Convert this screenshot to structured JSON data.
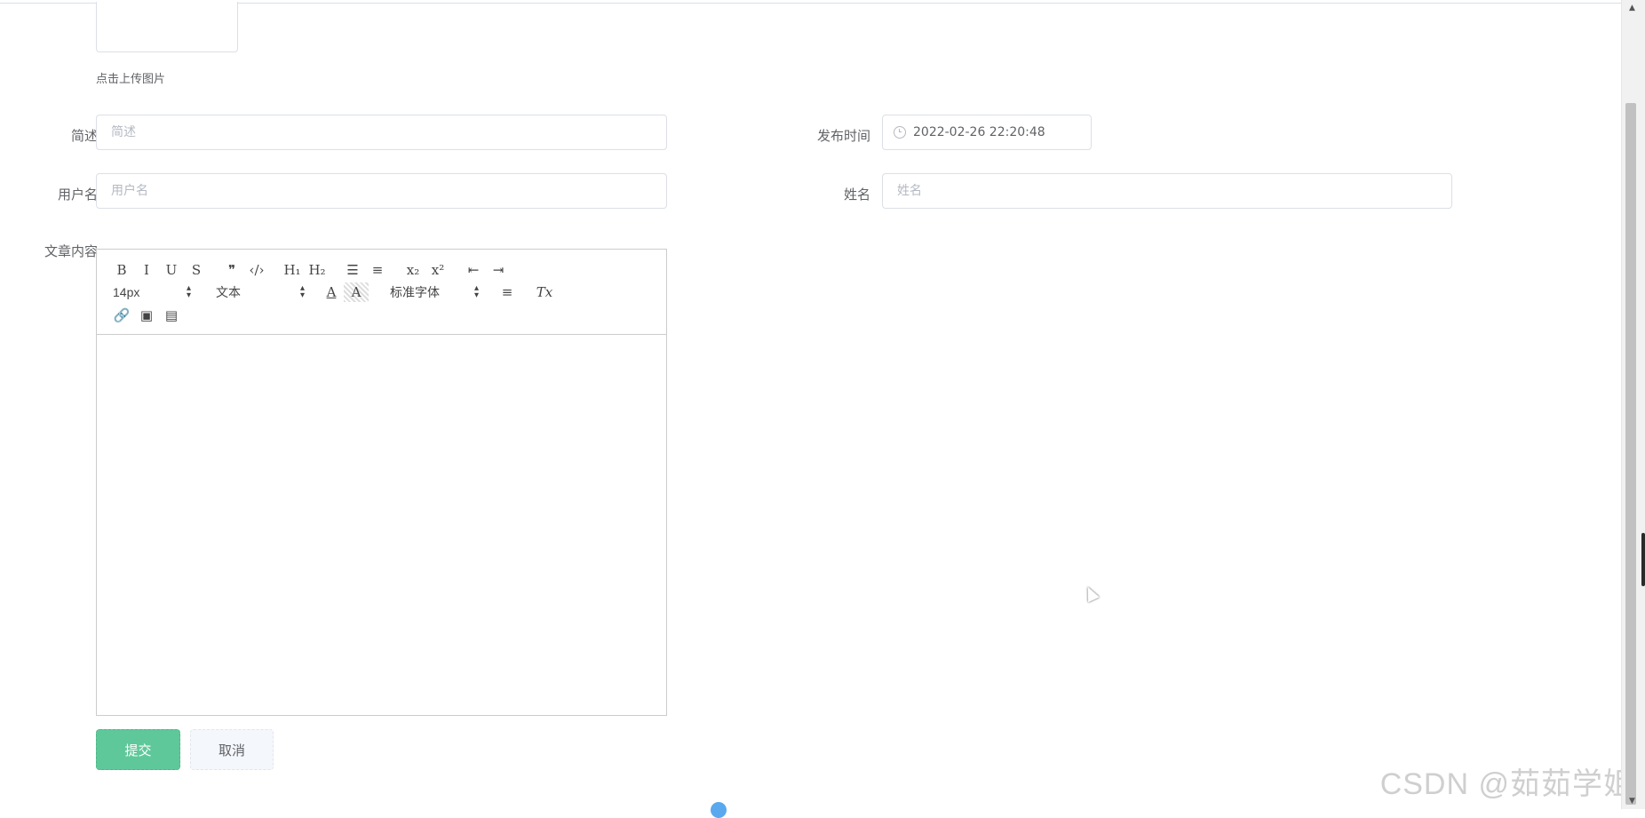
{
  "upload": {
    "tip": "点击上传图片"
  },
  "form": {
    "summary": {
      "label": "简述",
      "placeholder": "简述",
      "value": ""
    },
    "publish_time": {
      "label": "发布时间",
      "value": "2022-02-26 22:20:48"
    },
    "username": {
      "label": "用户名",
      "placeholder": "用户名",
      "value": ""
    },
    "fullname": {
      "label": "姓名",
      "placeholder": "姓名",
      "value": ""
    },
    "content": {
      "label": "文章内容"
    }
  },
  "editor": {
    "toolbar_row1": [
      {
        "name": "bold-icon",
        "glyph": "B"
      },
      {
        "name": "italic-icon",
        "glyph": "I"
      },
      {
        "name": "underline-icon",
        "glyph": "U"
      },
      {
        "name": "strike-icon",
        "glyph": "S"
      },
      {
        "name": "blockquote-icon",
        "glyph": "❞"
      },
      {
        "name": "code-block-icon",
        "glyph": "‹/›"
      },
      {
        "name": "header-1-icon",
        "glyph": "H₁"
      },
      {
        "name": "header-2-icon",
        "glyph": "H₂"
      },
      {
        "name": "ordered-list-icon",
        "glyph": "☰"
      },
      {
        "name": "bullet-list-icon",
        "glyph": "≡"
      },
      {
        "name": "subscript-icon",
        "glyph": "x₂"
      },
      {
        "name": "superscript-icon",
        "glyph": "x²"
      },
      {
        "name": "outdent-icon",
        "glyph": "⇤"
      },
      {
        "name": "indent-icon",
        "glyph": "⇥"
      }
    ],
    "size_picker": "14px",
    "header_picker": "文本",
    "font_picker": "标准字体",
    "toolbar_row3": [
      {
        "name": "link-icon",
        "glyph": "🔗"
      },
      {
        "name": "image-icon",
        "glyph": "▣"
      },
      {
        "name": "video-icon",
        "glyph": "▤"
      }
    ],
    "color_glyph": "A",
    "background_glyph": "A",
    "align_glyph": "≡",
    "clean_glyph": "Tx"
  },
  "buttons": {
    "submit": "提交",
    "cancel": "取消"
  },
  "watermark": "CSDN @茹茹学姐",
  "colors": {
    "primary": "#5fc89a",
    "border": "#dcdfe6"
  }
}
